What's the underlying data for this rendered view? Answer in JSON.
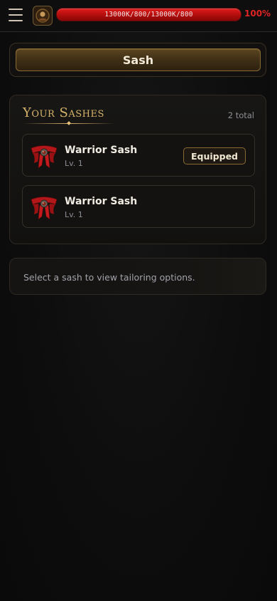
{
  "topbar": {
    "menu_icon": "hamburger-menu-icon",
    "avatar_icon": "character-portrait-icon",
    "hp_text": "13000K/800/13000K/800",
    "hp_percent_text": "100%",
    "hp_fill_fraction": 1.0,
    "hp_color": "#d31414"
  },
  "header": {
    "title": "Sash"
  },
  "sashes": {
    "title": "Your Sashes",
    "total_label": "2 total",
    "items": [
      {
        "name": "Warrior Sash",
        "level": "Lv. 1",
        "badge": "Equipped",
        "icon": "red-sash-icon"
      },
      {
        "name": "Warrior Sash",
        "level": "Lv. 1",
        "badge": "",
        "icon": "red-sash-icon"
      }
    ]
  },
  "info": {
    "message": "Select a sash to view tailoring options."
  },
  "colors": {
    "accent_gold": "#d8b36a",
    "hp_red": "#e02424",
    "background": "#0d0d0d"
  }
}
